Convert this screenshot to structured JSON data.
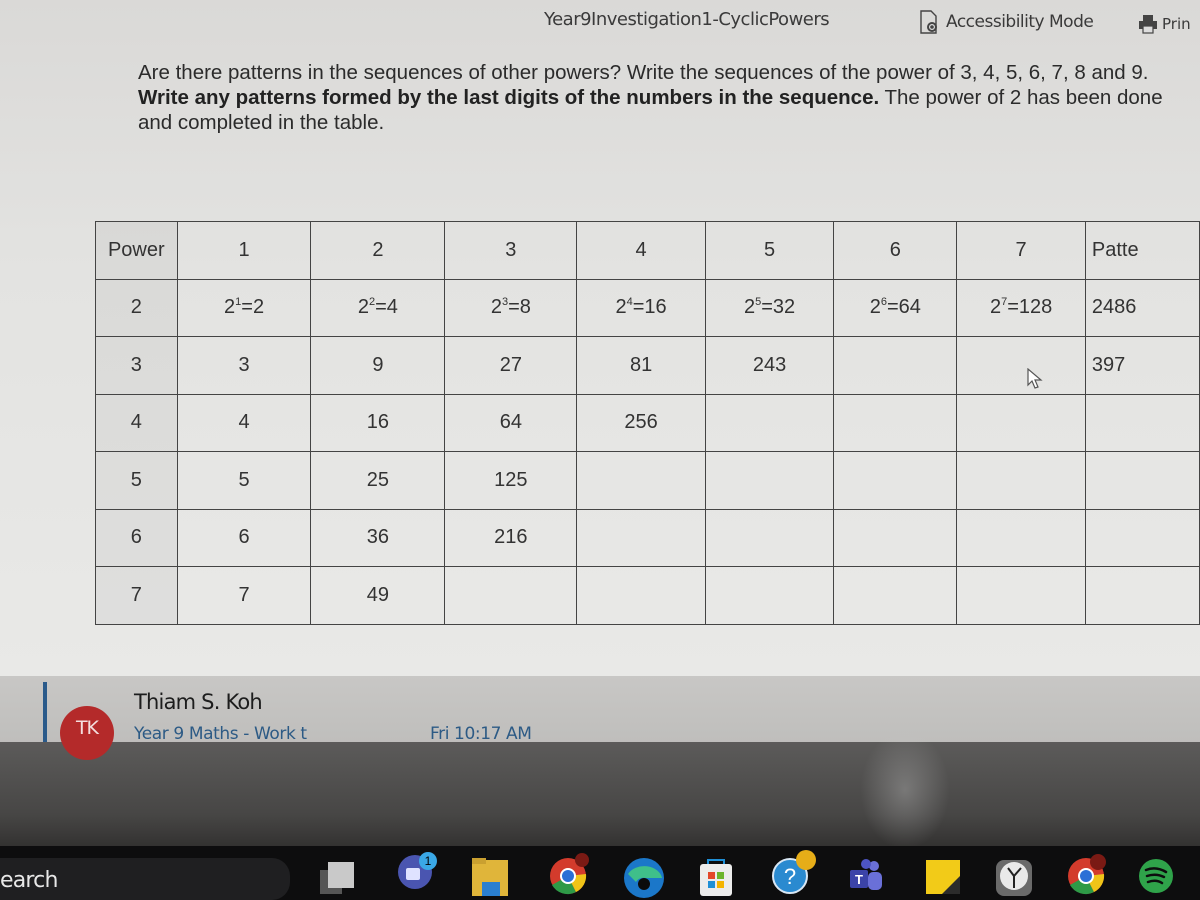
{
  "header": {
    "doc_title": "Year9Investigation1-CyclicPowers",
    "accessibility_label": "Accessibility Mode",
    "print_label": "Prin"
  },
  "instructions": {
    "line1_normal": "Are there patterns in the sequences of other powers? Write the sequences of the power of 3, 4, 5, 6, 7, 8 and 9. ",
    "line_bold": "Write any patterns formed by the last digits of the numbers in the sequence.",
    "line_end": " The power of 2 has been done and completed in the table."
  },
  "table": {
    "header": [
      "Power",
      "1",
      "2",
      "3",
      "4",
      "5",
      "6",
      "7",
      "Patte"
    ],
    "rows": [
      {
        "base": "2",
        "cells": [
          {
            "b": "2",
            "e": "1",
            "r": "=2"
          },
          {
            "b": "2",
            "e": "2",
            "r": "=4"
          },
          {
            "b": "2",
            "e": "3",
            "r": "=8"
          },
          {
            "b": "2",
            "e": "4",
            "r": "=16"
          },
          {
            "b": "2",
            "e": "5",
            "r": "=32"
          },
          {
            "b": "2",
            "e": "6",
            "r": "=64"
          },
          {
            "b": "2",
            "e": "7",
            "r": "=128"
          }
        ],
        "pattern": "2486"
      },
      {
        "base": "3",
        "cells": [
          "3",
          "9",
          "27",
          "81",
          "243",
          "",
          ""
        ],
        "pattern": "397"
      },
      {
        "base": "4",
        "cells": [
          "4",
          "16",
          "64",
          "256",
          "",
          "",
          ""
        ],
        "pattern": ""
      },
      {
        "base": "5",
        "cells": [
          "5",
          "25",
          "125",
          "",
          "",
          "",
          ""
        ],
        "pattern": ""
      },
      {
        "base": "6",
        "cells": [
          "6",
          "36",
          "216",
          "",
          "",
          "",
          ""
        ],
        "pattern": ""
      },
      {
        "base": "7",
        "cells": [
          "7",
          "49",
          "",
          "",
          "",
          "",
          ""
        ],
        "pattern": ""
      }
    ]
  },
  "notification": {
    "avatar_initials": "TK",
    "sender": "Thiam S. Koh",
    "channel": "Year 9 Maths - Work t",
    "time": "Fri 10:17 AM"
  },
  "taskbar": {
    "search_label": "earch",
    "icons": [
      {
        "name": "task-view-icon"
      },
      {
        "name": "teams-chat-icon",
        "badge": "1"
      },
      {
        "name": "file-explorer-icon"
      },
      {
        "name": "chrome-icon"
      },
      {
        "name": "edge-icon"
      },
      {
        "name": "microsoft-store-icon"
      },
      {
        "name": "get-help-icon"
      },
      {
        "name": "teams-icon"
      },
      {
        "name": "sticky-notes-icon"
      },
      {
        "name": "clock-icon"
      },
      {
        "name": "chrome-profile-icon"
      },
      {
        "name": "spotify-icon"
      }
    ]
  },
  "colors": {
    "avatar": "#b42a2a",
    "notif_accent": "#2a5a8a",
    "link_text": "#2c5a85"
  }
}
